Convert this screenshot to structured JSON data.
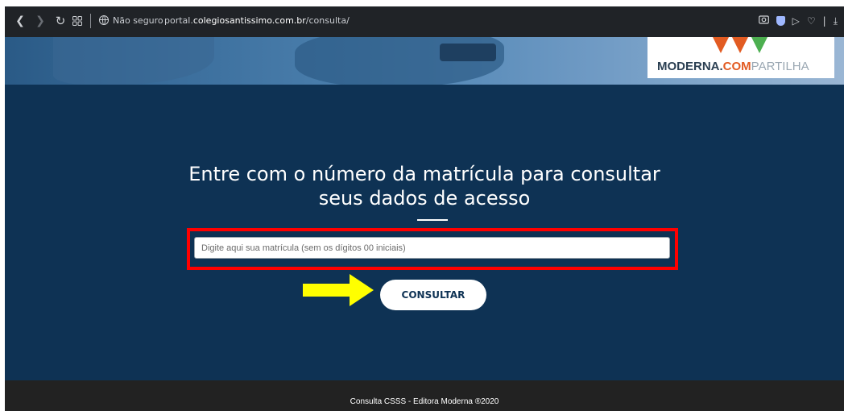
{
  "browser": {
    "security_label": "Não seguro",
    "url_prefix": "portal.",
    "url_domain": "colegiosantissimo.com.br",
    "url_path": "/consulta/"
  },
  "logo": {
    "brand_left": "MODERNA.",
    "brand_com": "COM",
    "brand_right": "PARTILHA"
  },
  "main": {
    "heading_line1": "Entre com o número da matrícula para consultar",
    "heading_line2": "seus dados de acesso",
    "input_placeholder": "Digite aqui sua matrícula (sem os dígitos 00 iniciais)",
    "input_value": "",
    "button_label": "CONSULTAR"
  },
  "annotations": {
    "highlight_color": "#ff0000",
    "arrow_color": "#ffff00"
  },
  "footer": {
    "text": "Consulta CSSS - Editora Moderna ®2020"
  },
  "icons": [
    "back-icon",
    "forward-icon",
    "reload-icon",
    "tab-grid-icon",
    "globe-icon",
    "camera-icon",
    "shield-icon",
    "send-icon",
    "heart-icon",
    "download-icon"
  ],
  "colors": {
    "panel": "#0e3254",
    "footer": "#222222",
    "browser_bar": "#202327"
  }
}
